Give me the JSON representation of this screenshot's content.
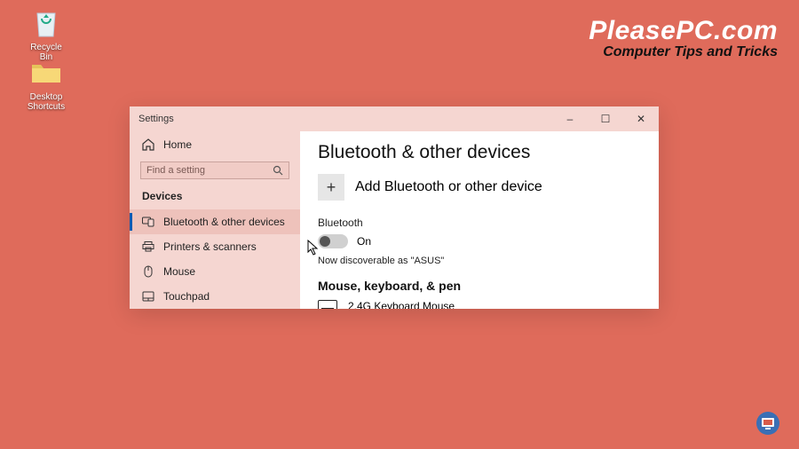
{
  "desktop": {
    "recycle": "Recycle Bin",
    "shortcuts": "Desktop Shortcuts"
  },
  "watermark": {
    "title": "PleasePC.com",
    "subtitle": "Computer Tips and Tricks"
  },
  "window": {
    "title": "Settings",
    "controls": {
      "min": "–",
      "max": "☐",
      "close": "✕"
    }
  },
  "sidebar": {
    "home": "Home",
    "search_placeholder": "Find a setting",
    "category": "Devices",
    "items": [
      {
        "label": "Bluetooth & other devices"
      },
      {
        "label": "Printers & scanners"
      },
      {
        "label": "Mouse"
      },
      {
        "label": "Touchpad"
      }
    ]
  },
  "main": {
    "heading": "Bluetooth & other devices",
    "add_label": "Add Bluetooth or other device",
    "add_plus": "+",
    "bt_label": "Bluetooth",
    "bt_state": "On",
    "discoverable": "Now discoverable as \"ASUS\"",
    "section2": "Mouse, keyboard, & pen",
    "device1": "2.4G Keyboard Mouse"
  }
}
